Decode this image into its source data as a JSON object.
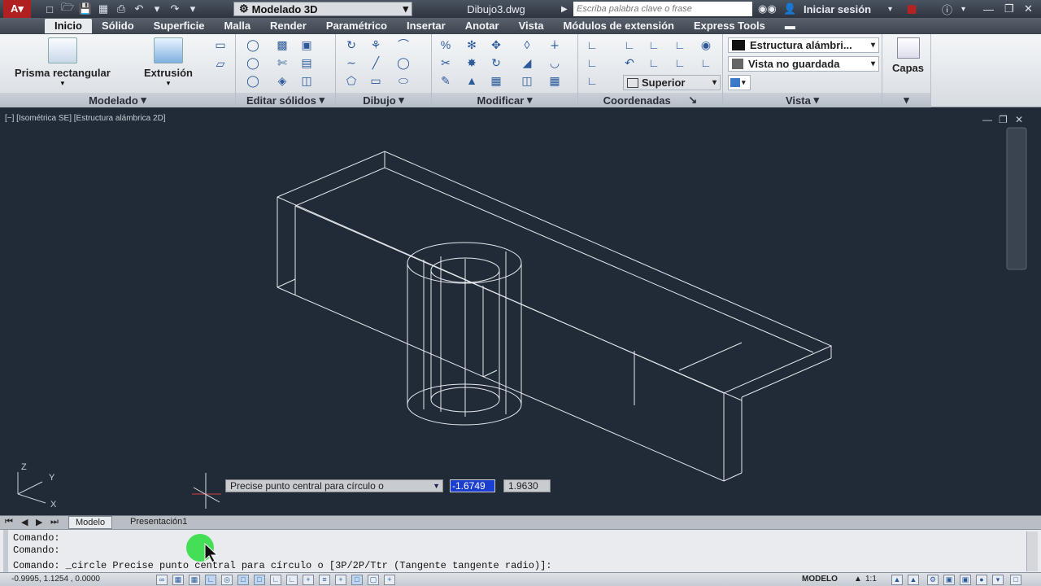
{
  "titlebar": {
    "workspace": "Modelado 3D",
    "filename": "Dibujo3.dwg",
    "search_placeholder": "Escriba palabra clave o frase",
    "signin": "Iniciar sesión"
  },
  "tabs": [
    "Inicio",
    "Sólido",
    "Superficie",
    "Malla",
    "Render",
    "Paramétrico",
    "Insertar",
    "Anotar",
    "Vista",
    "Módulos de extensión",
    "Express Tools"
  ],
  "ribbon": {
    "box_label": "Prisma rectangular",
    "extrude_label": "Extrusión",
    "panels": [
      "Modelado",
      "Editar sólidos",
      "Dibujo",
      "Modificar",
      "Coordenadas",
      "Vista"
    ],
    "visual_style": "Estructura alámbri...",
    "named_view": "Vista no guardada",
    "view_dir": "Superior",
    "layers_label": "Capas"
  },
  "viewport": {
    "label": "[−] [Isométrica SE] [Estructura alámbrica 2D]",
    "axis_x": "X",
    "axis_y": "Y",
    "axis_z": "Z"
  },
  "dynamic_input": {
    "prompt": "Precise punto central para círculo o",
    "x_value": "-1.6749",
    "y_value": "1.9630"
  },
  "layout_tabs": [
    "Modelo",
    "Presentación1"
  ],
  "command": {
    "line1": "Comando:",
    "line2": "Comando:",
    "line3": "Comando: _circle Precise punto central para círculo o [3P/2P/Ttr (Tangente tangente radio)]:"
  },
  "status": {
    "coords": "-0.9995, 1.1254 , 0.0000",
    "space": "MODELO",
    "scale": "1:1"
  },
  "colors": {
    "viewport_bg": "#212b37",
    "wire": "#e6e9ee",
    "input_highlight": "#1a3fcf"
  }
}
